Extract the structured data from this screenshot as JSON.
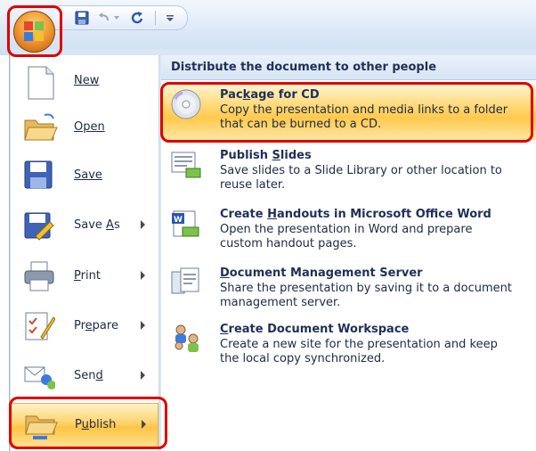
{
  "quick_access": {
    "items": [
      "save",
      "undo",
      "redo",
      "customize"
    ]
  },
  "left_menu": {
    "items": [
      {
        "id": "new",
        "label": "New",
        "underline_index": 0,
        "has_submenu": false
      },
      {
        "id": "open",
        "label": "Open",
        "underline_index": 0,
        "has_submenu": false
      },
      {
        "id": "save",
        "label": "Save",
        "underline_index": 0,
        "has_submenu": false
      },
      {
        "id": "save-as",
        "label": "Save As",
        "underline_index": 5,
        "has_submenu": true
      },
      {
        "id": "print",
        "label": "Print",
        "underline_index": 0,
        "has_submenu": true
      },
      {
        "id": "prepare",
        "label": "Prepare",
        "underline_index": 2,
        "has_submenu": true
      },
      {
        "id": "send",
        "label": "Send",
        "underline_index": 3,
        "has_submenu": true
      },
      {
        "id": "publish",
        "label": "Publish",
        "underline_index": 1,
        "has_submenu": true,
        "active": true
      }
    ]
  },
  "submenu": {
    "header": "Distribute the document to other people",
    "items": [
      {
        "id": "package-for-cd",
        "title": "Package for CD",
        "underline_index": 2,
        "description": "Copy the presentation and media links to a folder that can be burned to a CD.",
        "active": true
      },
      {
        "id": "publish-slides",
        "title": "Publish Slides",
        "underline_index": 8,
        "description": "Save slides to a Slide Library or other location to reuse later."
      },
      {
        "id": "create-handouts",
        "title": "Create Handouts in Microsoft Office Word",
        "underline_index": 7,
        "description": "Open the presentation in Word and prepare custom handout pages."
      },
      {
        "id": "document-management-server",
        "title": "Document Management Server",
        "underline_index": 0,
        "description": "Share the presentation by saving it to a document management server."
      },
      {
        "id": "create-document-workspace",
        "title": "Create Document Workspace",
        "underline_index": 0,
        "description": "Create a new site for the presentation and keep the local copy synchronized."
      }
    ]
  },
  "colors": {
    "highlight_red": "#e00000",
    "active_gold": "#ffc445",
    "menu_blue": "#d8e6f5"
  }
}
